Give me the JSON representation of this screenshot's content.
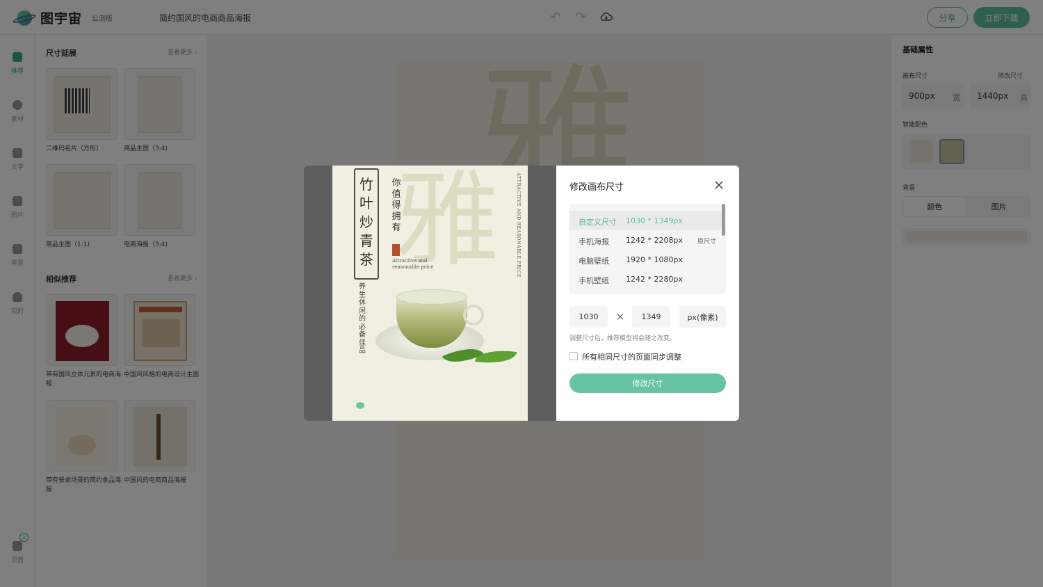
{
  "app": {
    "logo_text": "图宇宙",
    "beta_label": "公测版",
    "doc_title": "简约国风的电商商品海报"
  },
  "header": {
    "undo_icon": "undo-icon",
    "redo_icon": "redo-icon",
    "cloud_icon": "cloud-save-icon",
    "share_label": "分享",
    "download_label": "立即下载"
  },
  "rail": {
    "items": [
      {
        "label": "推荐",
        "icon": "recommend-icon"
      },
      {
        "label": "素材",
        "icon": "shapes-icon"
      },
      {
        "label": "文字",
        "icon": "text-icon"
      },
      {
        "label": "图片",
        "icon": "image-icon"
      },
      {
        "label": "背景",
        "icon": "background-icon"
      },
      {
        "label": "我的",
        "icon": "user-icon"
      }
    ],
    "pages_label": "页面",
    "page_count": "1"
  },
  "panel": {
    "size_section_title": "尺寸延展",
    "similar_section_title": "相似推荐",
    "more_label": "查看更多",
    "size_items": [
      {
        "label": "二维码名片（方形）"
      },
      {
        "label": "商品主图（3:4)"
      },
      {
        "label": "商品主图（1:1)"
      },
      {
        "label": "电商海报（3:4)"
      }
    ],
    "similar_items": [
      {
        "label": "带有国风立体元素的电商海报"
      },
      {
        "label": "中国风风格的电商设计主图"
      },
      {
        "label": "带有餐桌场景的简约食品海报"
      },
      {
        "label": "中国风的电商商品海报"
      }
    ]
  },
  "right_panel": {
    "title": "基础属性",
    "canvas_size_label": "画布尺寸",
    "modify_size_link": "修改尺寸",
    "width_value": "900px",
    "width_unit": "宽",
    "height_value": "1440px",
    "height_unit": "高",
    "smart_color_label": "智能配色",
    "swatches": [
      "#efe9df",
      "#c9c7a4"
    ],
    "background_label": "背景",
    "bg_tabs": [
      "颜色",
      "图片"
    ]
  },
  "poster": {
    "title_chars": "竹叶炒青茶",
    "subtitle": "你值得拥有",
    "big_char": "雅",
    "en_text_line1": "Attractive and",
    "en_text_line2": "reasonable price",
    "side_text": "养生休闲的必备佳品",
    "right_vertical": "ATTRACTIVE AND REASONABLE PRICE"
  },
  "modal": {
    "title": "修改画布尺寸",
    "close_icon": "close-icon",
    "sizes": [
      {
        "name": "自定义尺寸",
        "dim": "1030 * 1349px",
        "tag": "",
        "selected": true
      },
      {
        "name": "手机海报",
        "dim": "1242 * 2208px",
        "tag": "原尺寸",
        "selected": false
      },
      {
        "name": "电脑壁纸",
        "dim": "1920 * 1080px",
        "tag": "",
        "selected": false
      },
      {
        "name": "手机壁纸",
        "dim": "1242 * 2280px",
        "tag": "",
        "selected": false
      }
    ],
    "width_input": "1030",
    "height_input": "1349",
    "unit_select": "px(像素)",
    "times_symbol": "×",
    "hint": "调整尺寸后，推荐模型将会随之改变。",
    "sync_label": "所有相同尺寸的页面同步调整",
    "submit_label": "修改尺寸"
  }
}
